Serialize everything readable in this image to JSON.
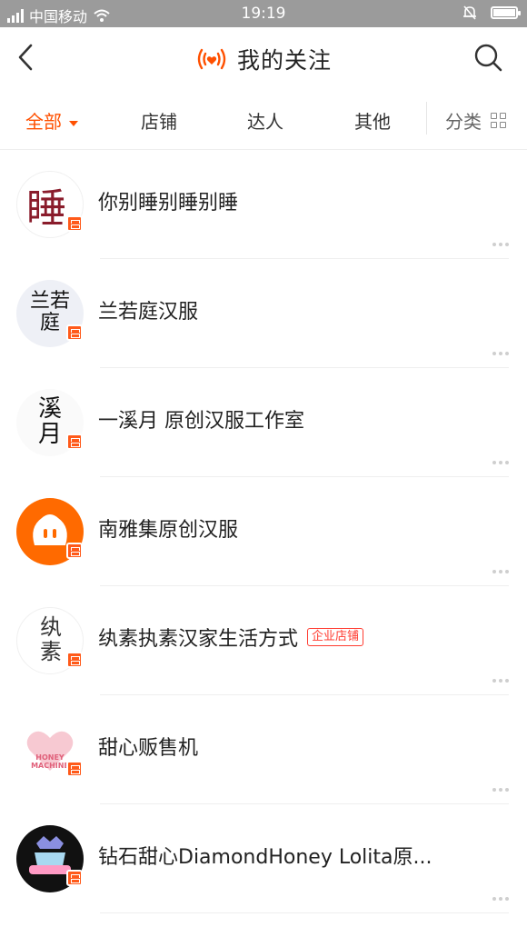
{
  "status_bar": {
    "carrier": "中国移动",
    "time": "19:19"
  },
  "header": {
    "title": "我的关注"
  },
  "tabs": {
    "all": "全部",
    "shops": "店铺",
    "influencers": "达人",
    "others": "其他",
    "category": "分类"
  },
  "follows": [
    {
      "name": "你别睡别睡别睡",
      "avatar_text": "睡"
    },
    {
      "name": "兰若庭汉服",
      "avatar_text": "兰若庭"
    },
    {
      "name": "一溪月 原创汉服工作室",
      "avatar_text": "溪月"
    },
    {
      "name": "南雅集原创汉服"
    },
    {
      "name": "纨素执素汉家生活方式",
      "tag": "企业店铺",
      "avatar_text": "纨素"
    },
    {
      "name": "甜心贩售机",
      "avatar_text": "HONEY MACHINE"
    },
    {
      "name": "钻石甜心DiamondHoney Lolita原..."
    }
  ],
  "colors": {
    "accent": "#ff5000",
    "badge": "#ff5a1a",
    "enterprise_tag": "#ff3b30",
    "status_bar": "#9b9b9b"
  },
  "icons": [
    "back-arrow-icon",
    "live-broadcast-icon",
    "search-icon",
    "grid-icon",
    "shop-badge-icon",
    "more-dots-icon"
  ]
}
